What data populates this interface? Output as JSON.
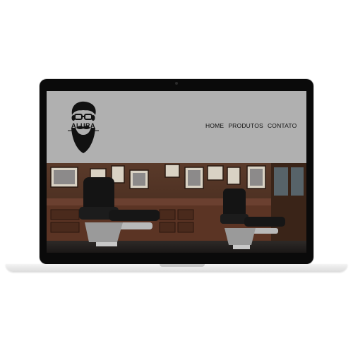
{
  "site": {
    "logo_text": "ALURA",
    "nav": [
      "HOME",
      "PRODUTOS",
      "CONTATO"
    ]
  },
  "colors": {
    "header_bg": "#b0b0b0",
    "text": "#111111",
    "frame": "#0a0a0a"
  },
  "icons": [
    "bearded-man-logo-icon"
  ]
}
